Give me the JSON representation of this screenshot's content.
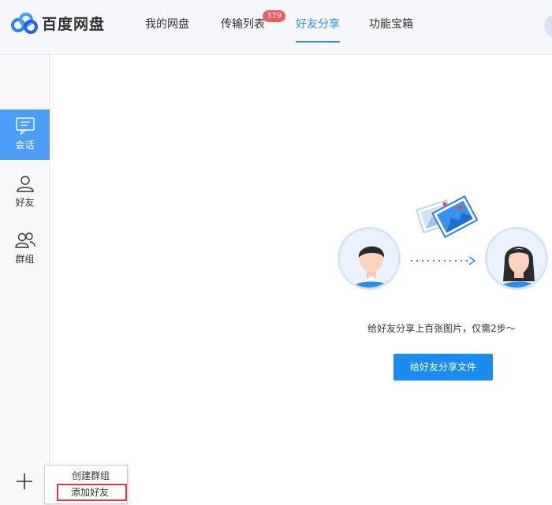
{
  "header": {
    "logo_text": "百度网盘",
    "tabs": [
      {
        "label": "我的网盘"
      },
      {
        "label": "传输列表",
        "badge": "379"
      },
      {
        "label": "好友分享",
        "active": true
      },
      {
        "label": "功能宝箱"
      }
    ]
  },
  "sidebar": {
    "items": [
      {
        "label": "会话",
        "icon": "chat-icon",
        "active": true
      },
      {
        "label": "好友",
        "icon": "person-icon"
      },
      {
        "label": "群组",
        "icon": "group-icon"
      }
    ],
    "add_icon": "plus-icon"
  },
  "popup_menu": {
    "items": [
      {
        "label": "创建群组"
      },
      {
        "label": "添加好友",
        "highlighted": true
      }
    ]
  },
  "main": {
    "tip": "给好友分享上百张图片，仅需2步～",
    "share_button": "给好友分享文件"
  },
  "colors": {
    "accent": "#2a8ff7",
    "button": "#1a8cf0",
    "sidebar_active": "#4a9ef5",
    "badge": "#f25b5b",
    "highlight_border": "#e0393e"
  }
}
